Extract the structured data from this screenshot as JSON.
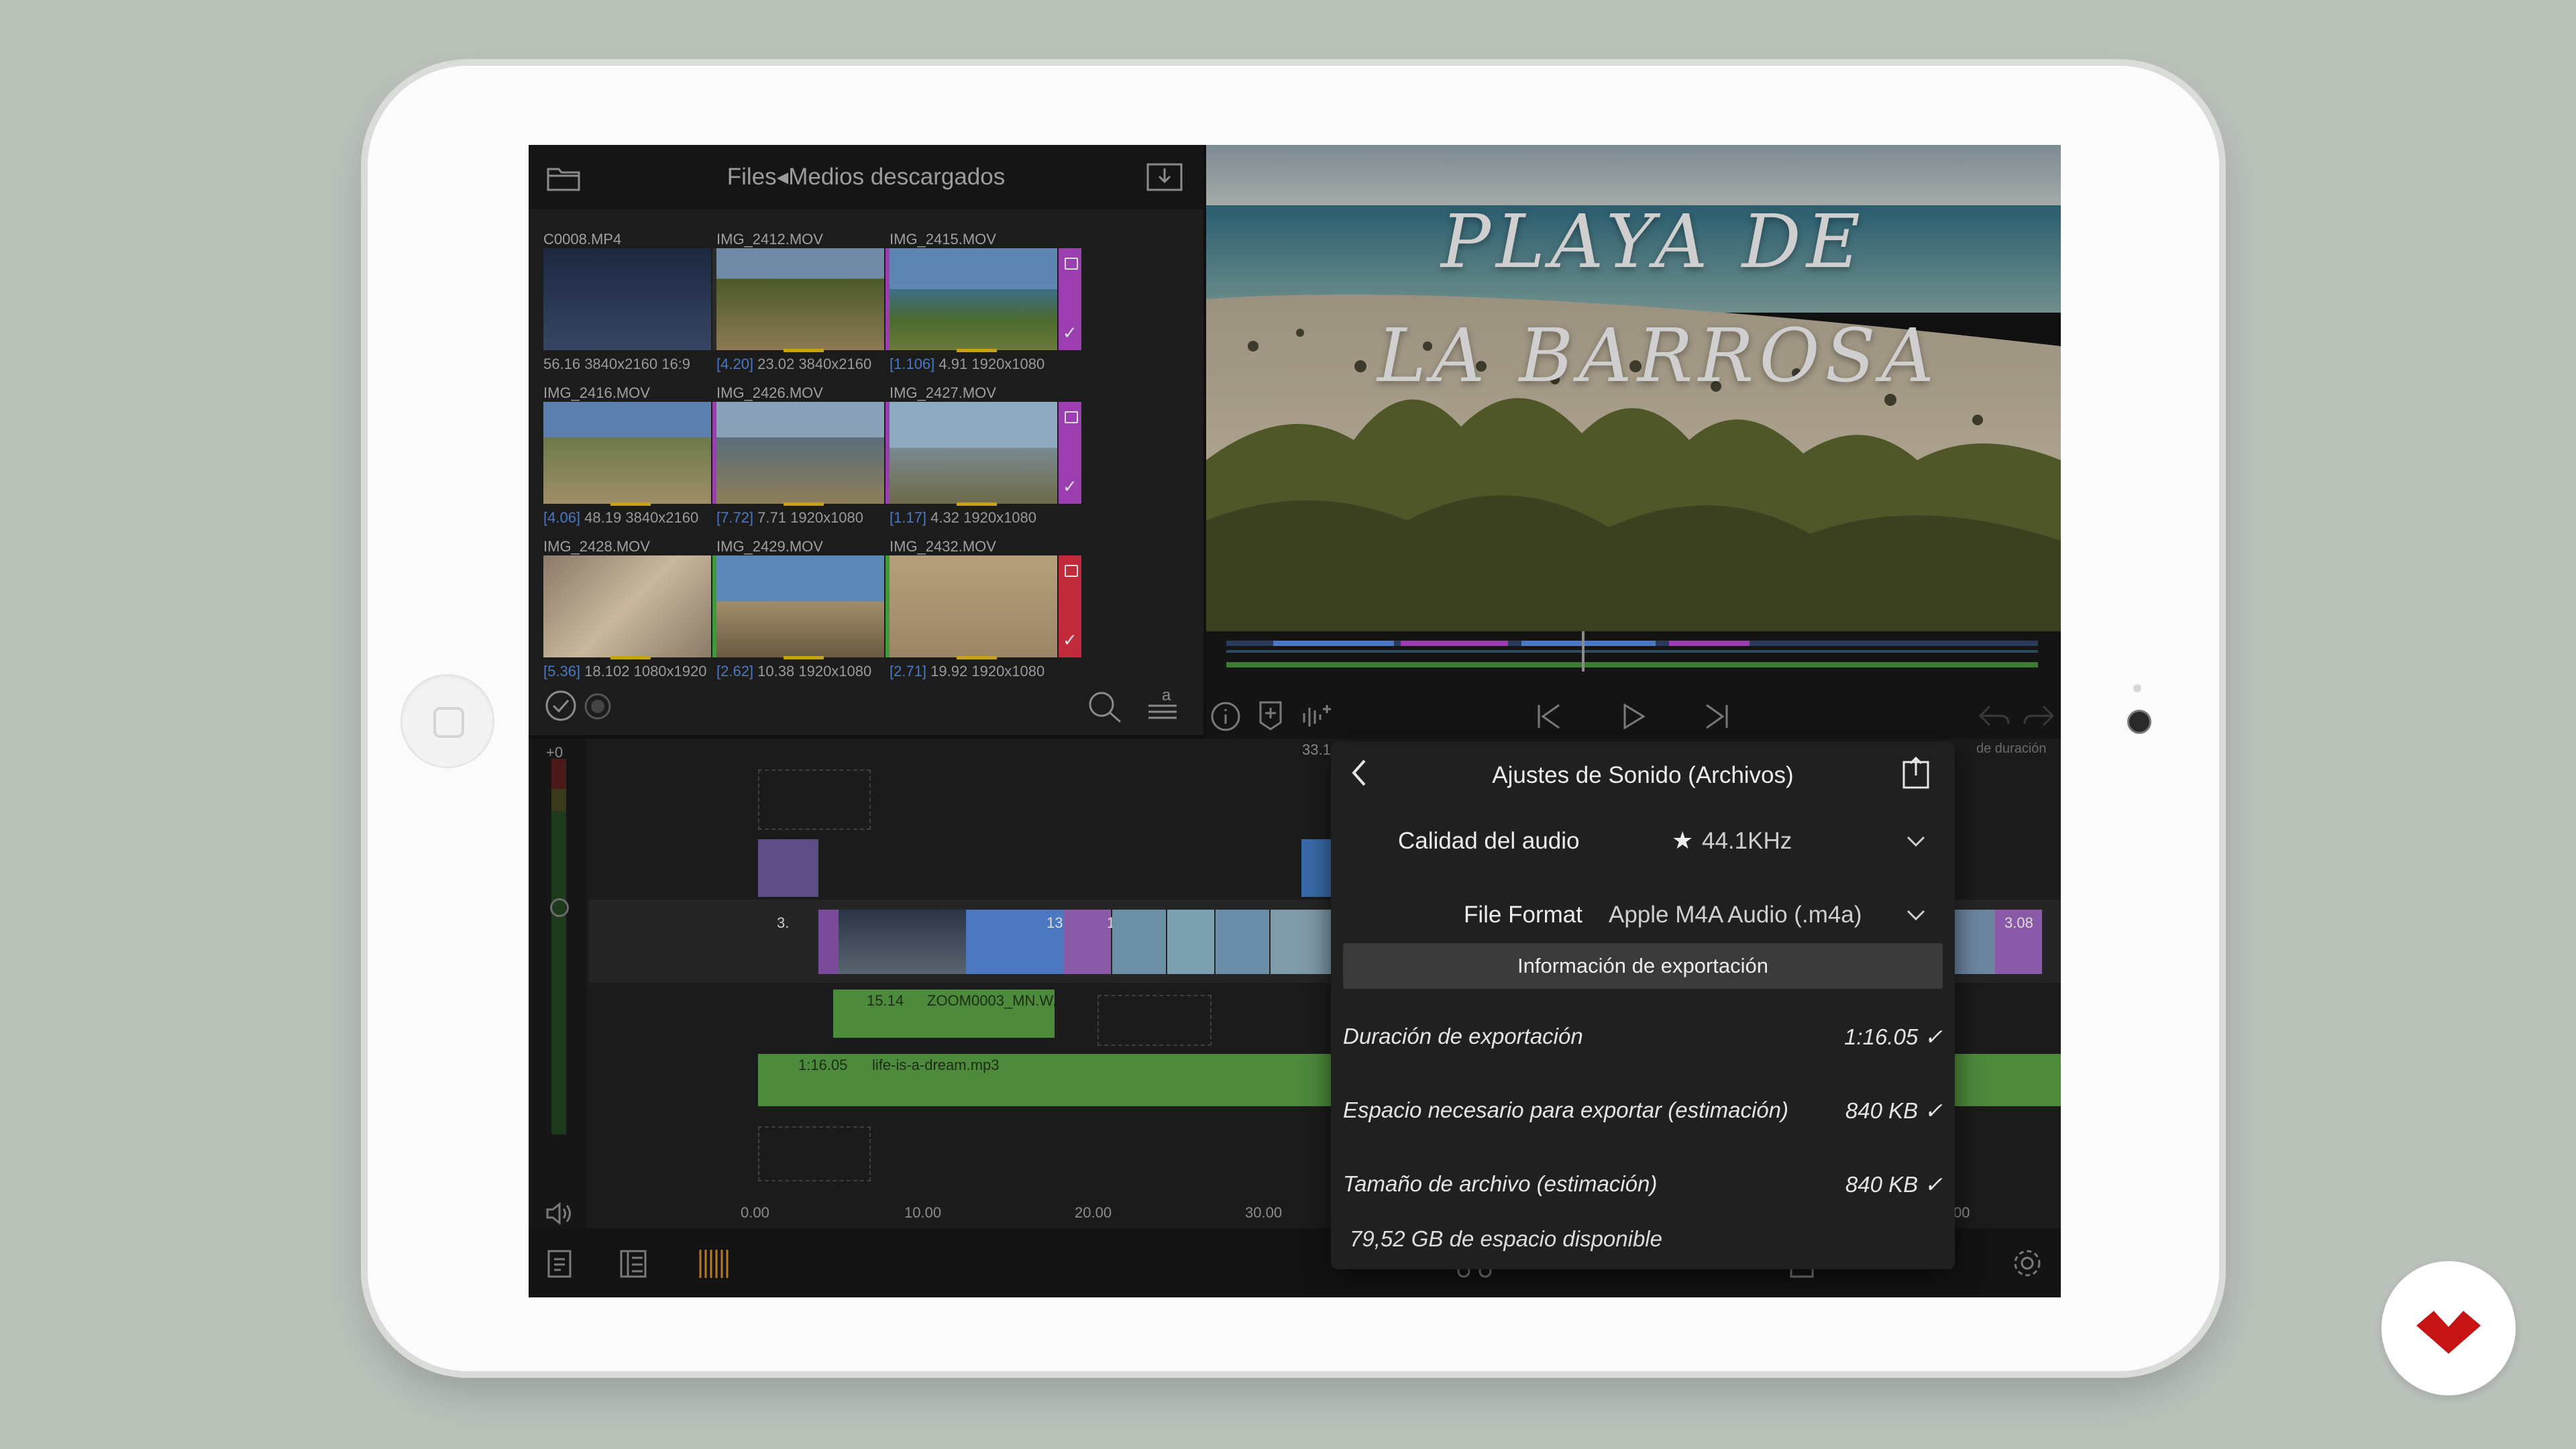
{
  "media_browser": {
    "breadcrumb_root": "Files",
    "breadcrumb_arrow": "◂",
    "breadcrumb_folder": "Medios descargados",
    "clips": [
      {
        "name": "C0008.MP4",
        "badge": "",
        "duration": "56.16",
        "resolution": "3840x2160",
        "extra": "16:9",
        "bar_color": "#2b2b2b"
      },
      {
        "name": "IMG_2412.MOV",
        "badge": "[4.20]",
        "duration": "23.02",
        "resolution": "3840x2160",
        "extra": "",
        "bar_color": "#9b3fb0"
      },
      {
        "name": "IMG_2415.MOV",
        "badge": "[1.106]",
        "duration": "4.91",
        "resolution": "1920x1080",
        "extra": "",
        "bar_color": "#9b3fb0"
      },
      {
        "name": "IMG_2416.MOV",
        "badge": "[4.06]",
        "duration": "48.19",
        "resolution": "3840x2160",
        "extra": "",
        "bar_color": "#9b3fb0"
      },
      {
        "name": "IMG_2426.MOV",
        "badge": "[7.72]",
        "duration": "7.71",
        "resolution": "1920x1080",
        "extra": "",
        "bar_color": "#9b3fb0"
      },
      {
        "name": "IMG_2427.MOV",
        "badge": "[1.17]",
        "duration": "4.32",
        "resolution": "1920x1080",
        "extra": "",
        "bar_color": "#9b3fb0"
      },
      {
        "name": "IMG_2428.MOV",
        "badge": "[5.36]",
        "duration": "18.102",
        "resolution": "1080x1920",
        "extra": "",
        "bar_color": "#3f9b3a"
      },
      {
        "name": "IMG_2429.MOV",
        "badge": "[2.62]",
        "duration": "10.38",
        "resolution": "1920x1080",
        "extra": "",
        "bar_color": "#3f9b3a"
      },
      {
        "name": "IMG_2432.MOV",
        "badge": "[2.71]",
        "duration": "19.92",
        "resolution": "1920x1080",
        "extra": "",
        "bar_color": "#c02a3a"
      }
    ]
  },
  "preview": {
    "title_line1": "PLAYA DE",
    "title_line2": "LA BARROSA"
  },
  "timeline": {
    "level_label": "+0",
    "playhead_time": "33.1",
    "duration_note": "de duración",
    "ruler": [
      "0.00",
      "10.00",
      "20.00",
      "30.00",
      "00"
    ],
    "video_clip_labels": [
      "3.",
      "13.",
      "1",
      "3.08"
    ],
    "audio_clip_1": {
      "duration": "15.14",
      "name": "ZOOM0003_MN.W."
    },
    "audio_clip_2": {
      "duration": "1:16.05",
      "name": "life-is-a-dream.mp3"
    }
  },
  "popover": {
    "title": "Ajustes de Sonido (Archivos)",
    "audio_quality_label": "Calidad del audio",
    "audio_quality_value": "44.1KHz",
    "file_format_label": "File Format",
    "file_format_value": "Apple M4A Audio (.m4a)",
    "section_header": "Información de exportación",
    "rows": [
      {
        "label": "Duración de exportación",
        "value": "1:16.05"
      },
      {
        "label": "Espacio necesario para exportar (estimación)",
        "value": "840 KB"
      },
      {
        "label": "Tamaño de archivo (estimación)",
        "value": "840 KB"
      }
    ],
    "check_mark": "✓",
    "free_space": "79,52 GB de espacio disponible"
  },
  "icons": [
    "folder-icon",
    "import-icon",
    "select-all-icon",
    "record-icon",
    "search-icon",
    "sort-icon",
    "info-icon",
    "marker-icon",
    "audio-add-icon",
    "skip-back-icon",
    "play-icon",
    "skip-forward-icon",
    "undo-icon",
    "redo-icon",
    "speaker-icon",
    "back-chevron-icon",
    "share-icon",
    "chevron-down-icon",
    "star-icon",
    "settings-gear-icon",
    "brand-logo-icon"
  ],
  "colors": {
    "accent_purple": "#9b3fb0",
    "accent_green": "#3f9b3a",
    "accent_red": "#c02a3a",
    "clip_blue": "#4b78c0",
    "audio_green": "#4d8a3c",
    "brand_red": "#c61414"
  }
}
